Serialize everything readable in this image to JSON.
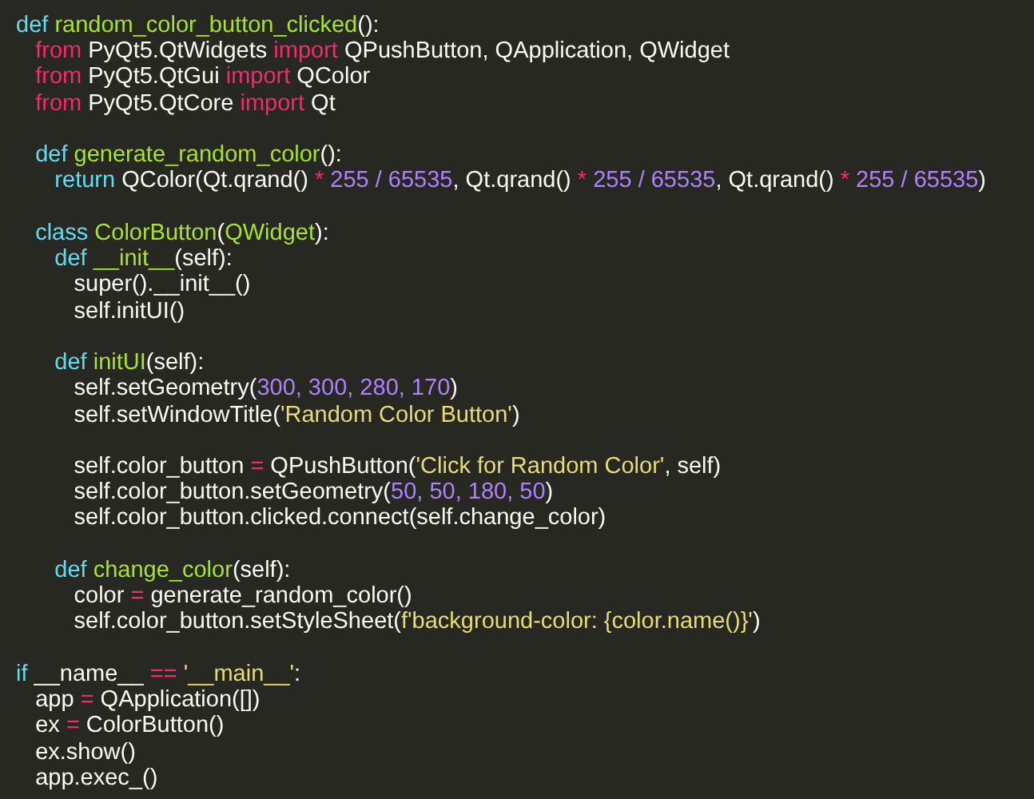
{
  "editor": {
    "lines": [
      {
        "kind": "code",
        "tokens": [
          {
            "text": "def ",
            "kind": "decl"
          },
          {
            "text": "random_color_button_clicked",
            "kind": "name"
          },
          {
            "text": "():",
            "kind": "plain"
          }
        ]
      },
      {
        "kind": "code",
        "tokens": [
          {
            "text": "   from",
            "kind": "kw"
          },
          {
            "text": " PyQt5.QtWidgets ",
            "kind": "plain"
          },
          {
            "text": "import",
            "kind": "kw"
          },
          {
            "text": " QPushButton, QApplication, QWidget",
            "kind": "plain"
          }
        ]
      },
      {
        "kind": "code",
        "tokens": [
          {
            "text": "   from",
            "kind": "kw"
          },
          {
            "text": " PyQt5.QtGui ",
            "kind": "plain"
          },
          {
            "text": "import",
            "kind": "kw"
          },
          {
            "text": " QColor",
            "kind": "plain"
          }
        ]
      },
      {
        "kind": "code",
        "tokens": [
          {
            "text": "   from",
            "kind": "kw"
          },
          {
            "text": " PyQt5.QtCore ",
            "kind": "plain"
          },
          {
            "text": "import",
            "kind": "kw"
          },
          {
            "text": " Qt",
            "kind": "plain"
          }
        ]
      },
      {
        "kind": "blank"
      },
      {
        "kind": "code",
        "tokens": [
          {
            "text": "   def ",
            "kind": "decl"
          },
          {
            "text": "generate_random_color",
            "kind": "name"
          },
          {
            "text": "():",
            "kind": "plain"
          }
        ]
      },
      {
        "kind": "code",
        "tokens": [
          {
            "text": "      return",
            "kind": "decl"
          },
          {
            "text": " QColor(Qt.qrand() ",
            "kind": "plain"
          },
          {
            "text": "* ",
            "kind": "op"
          },
          {
            "text": "255 / 65535",
            "kind": "num"
          },
          {
            "text": ", Qt.qrand() ",
            "kind": "plain"
          },
          {
            "text": "* ",
            "kind": "op"
          },
          {
            "text": "255 / 65535",
            "kind": "num"
          },
          {
            "text": ", Qt.qrand() ",
            "kind": "plain"
          },
          {
            "text": "* ",
            "kind": "op"
          },
          {
            "text": "255 / 65535",
            "kind": "num"
          },
          {
            "text": ")",
            "kind": "plain"
          }
        ]
      },
      {
        "kind": "blank"
      },
      {
        "kind": "code",
        "tokens": [
          {
            "text": "   class ",
            "kind": "decl"
          },
          {
            "text": "ColorButton",
            "kind": "name"
          },
          {
            "text": "(",
            "kind": "plain"
          },
          {
            "text": "QWidget",
            "kind": "name"
          },
          {
            "text": "):",
            "kind": "plain"
          }
        ]
      },
      {
        "kind": "code",
        "tokens": [
          {
            "text": "      def ",
            "kind": "decl"
          },
          {
            "text": "__init__",
            "kind": "name"
          },
          {
            "text": "(self):",
            "kind": "plain"
          }
        ]
      },
      {
        "kind": "code",
        "tokens": [
          {
            "text": "         super().__init__()",
            "kind": "plain"
          }
        ]
      },
      {
        "kind": "code",
        "tokens": [
          {
            "text": "         self.initUI()",
            "kind": "plain"
          }
        ]
      },
      {
        "kind": "blank"
      },
      {
        "kind": "code",
        "tokens": [
          {
            "text": "      def ",
            "kind": "decl"
          },
          {
            "text": "initUI",
            "kind": "name"
          },
          {
            "text": "(self):",
            "kind": "plain"
          }
        ]
      },
      {
        "kind": "code",
        "tokens": [
          {
            "text": "         self.setGeometry(",
            "kind": "plain"
          },
          {
            "text": "300, 300, 280, 170",
            "kind": "num"
          },
          {
            "text": ")",
            "kind": "plain"
          }
        ]
      },
      {
        "kind": "code",
        "tokens": [
          {
            "text": "         self.setWindowTitle(",
            "kind": "plain"
          },
          {
            "text": "'Random Color Button'",
            "kind": "str"
          },
          {
            "text": ")",
            "kind": "plain"
          }
        ]
      },
      {
        "kind": "blank"
      },
      {
        "kind": "code",
        "tokens": [
          {
            "text": "         self.color_button ",
            "kind": "plain"
          },
          {
            "text": "=",
            "kind": "op"
          },
          {
            "text": " QPushButton(",
            "kind": "plain"
          },
          {
            "text": "'Click for Random Color'",
            "kind": "str"
          },
          {
            "text": ", self)",
            "kind": "plain"
          }
        ]
      },
      {
        "kind": "code",
        "tokens": [
          {
            "text": "         self.color_button.setGeometry(",
            "kind": "plain"
          },
          {
            "text": "50, 50, 180, 50",
            "kind": "num"
          },
          {
            "text": ")",
            "kind": "plain"
          }
        ]
      },
      {
        "kind": "code",
        "tokens": [
          {
            "text": "         self.color_button.clicked.connect(self.change_color)",
            "kind": "plain"
          }
        ]
      },
      {
        "kind": "blank"
      },
      {
        "kind": "code",
        "tokens": [
          {
            "text": "      def ",
            "kind": "decl"
          },
          {
            "text": "change_color",
            "kind": "name"
          },
          {
            "text": "(self):",
            "kind": "plain"
          }
        ]
      },
      {
        "kind": "code",
        "tokens": [
          {
            "text": "         color ",
            "kind": "plain"
          },
          {
            "text": "=",
            "kind": "op"
          },
          {
            "text": " generate_random_color()",
            "kind": "plain"
          }
        ]
      },
      {
        "kind": "code",
        "tokens": [
          {
            "text": "         self.color_button.setStyleSheet(",
            "kind": "plain"
          },
          {
            "text": "f'background-color: {color.name()}'",
            "kind": "str"
          },
          {
            "text": ")",
            "kind": "plain"
          }
        ]
      },
      {
        "kind": "blank"
      },
      {
        "kind": "code",
        "tokens": [
          {
            "text": "if",
            "kind": "decl"
          },
          {
            "text": " __name__ ",
            "kind": "plain"
          },
          {
            "text": "== ",
            "kind": "op"
          },
          {
            "text": "'__main__'",
            "kind": "str"
          },
          {
            "text": ":",
            "kind": "plain"
          }
        ]
      },
      {
        "kind": "code",
        "tokens": [
          {
            "text": "   app ",
            "kind": "plain"
          },
          {
            "text": "=",
            "kind": "op"
          },
          {
            "text": " QApplication([])",
            "kind": "plain"
          }
        ]
      },
      {
        "kind": "code",
        "tokens": [
          {
            "text": "   ex ",
            "kind": "plain"
          },
          {
            "text": "=",
            "kind": "op"
          },
          {
            "text": " ColorButton()",
            "kind": "plain"
          }
        ]
      },
      {
        "kind": "code",
        "tokens": [
          {
            "text": "   ex.show()",
            "kind": "plain"
          }
        ]
      },
      {
        "kind": "code",
        "tokens": [
          {
            "text": "   app.exec_()",
            "kind": "plain"
          }
        ]
      }
    ]
  }
}
